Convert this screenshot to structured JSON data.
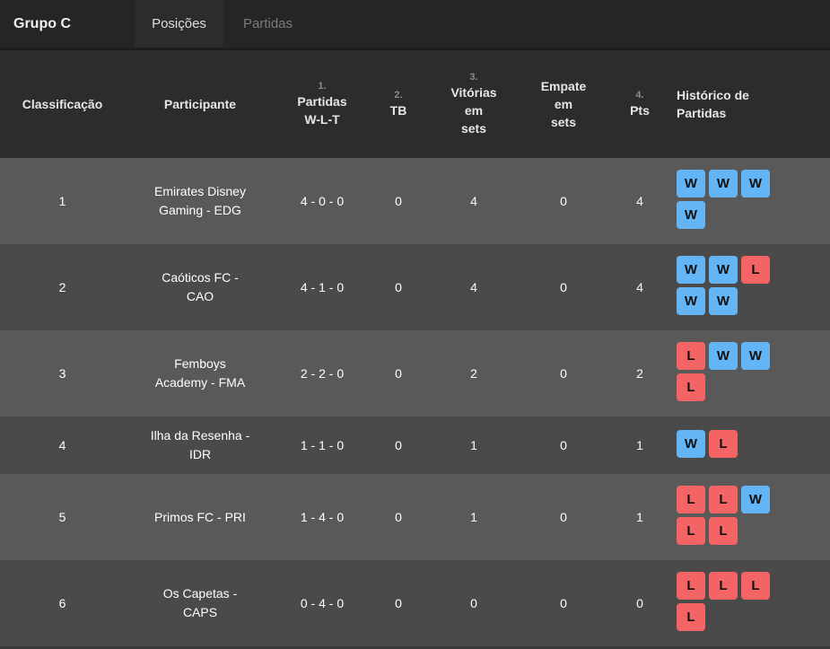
{
  "header": {
    "group_title": "Grupo C",
    "tabs": [
      {
        "label": "Posições",
        "active": true
      },
      {
        "label": "Partidas",
        "active": false
      }
    ]
  },
  "columns": {
    "rank": {
      "label": "Classificação"
    },
    "participant": {
      "label": "Participante"
    },
    "matches": {
      "num": "1.",
      "label": "Partidas",
      "sub": "W-L-T"
    },
    "tb": {
      "num": "2.",
      "label": "TB"
    },
    "set_wins": {
      "num": "3.",
      "label1": "Vitórias",
      "label2": "em",
      "label3": "sets"
    },
    "set_draws": {
      "label1": "Empate",
      "label2": "em",
      "label3": "sets"
    },
    "pts": {
      "num": "4.",
      "label": "Pts"
    },
    "history": {
      "label1": "Histórico de",
      "label2": "Partidas"
    }
  },
  "colors": {
    "win": "#64b5f6",
    "loss": "#f46464",
    "row_light": "#595959",
    "row_dark": "#4a4a4a",
    "header_bg": "#2c2c2c"
  },
  "rows": [
    {
      "rank": "1",
      "name1": "Emirates Disney",
      "name2": "Gaming - EDG",
      "record": "4 - 0 - 0",
      "tb": "0",
      "set_wins": "4",
      "set_draws": "0",
      "pts": "4",
      "history": [
        "W",
        "W",
        "W",
        "W"
      ]
    },
    {
      "rank": "2",
      "name1": "Caóticos FC -",
      "name2": "CAO",
      "record": "4 - 1 - 0",
      "tb": "0",
      "set_wins": "4",
      "set_draws": "0",
      "pts": "4",
      "history": [
        "W",
        "W",
        "L",
        "W",
        "W"
      ]
    },
    {
      "rank": "3",
      "name1": "Femboys",
      "name2": "Academy - FMA",
      "record": "2 - 2 - 0",
      "tb": "0",
      "set_wins": "2",
      "set_draws": "0",
      "pts": "2",
      "history": [
        "L",
        "W",
        "W",
        "L"
      ]
    },
    {
      "rank": "4",
      "name1": "Ilha da Resenha -",
      "name2": "IDR",
      "record": "1 - 1 - 0",
      "tb": "0",
      "set_wins": "1",
      "set_draws": "0",
      "pts": "1",
      "history": [
        "W",
        "L"
      ]
    },
    {
      "rank": "5",
      "name1": "Primos FC - PRI",
      "name2": "",
      "record": "1 - 4 - 0",
      "tb": "0",
      "set_wins": "1",
      "set_draws": "0",
      "pts": "1",
      "history": [
        "L",
        "L",
        "W",
        "L",
        "L"
      ]
    },
    {
      "rank": "6",
      "name1": "Os Capetas -",
      "name2": "CAPS",
      "record": "0 - 4 - 0",
      "tb": "0",
      "set_wins": "0",
      "set_draws": "0",
      "pts": "0",
      "history": [
        "L",
        "L",
        "L",
        "L"
      ]
    }
  ]
}
